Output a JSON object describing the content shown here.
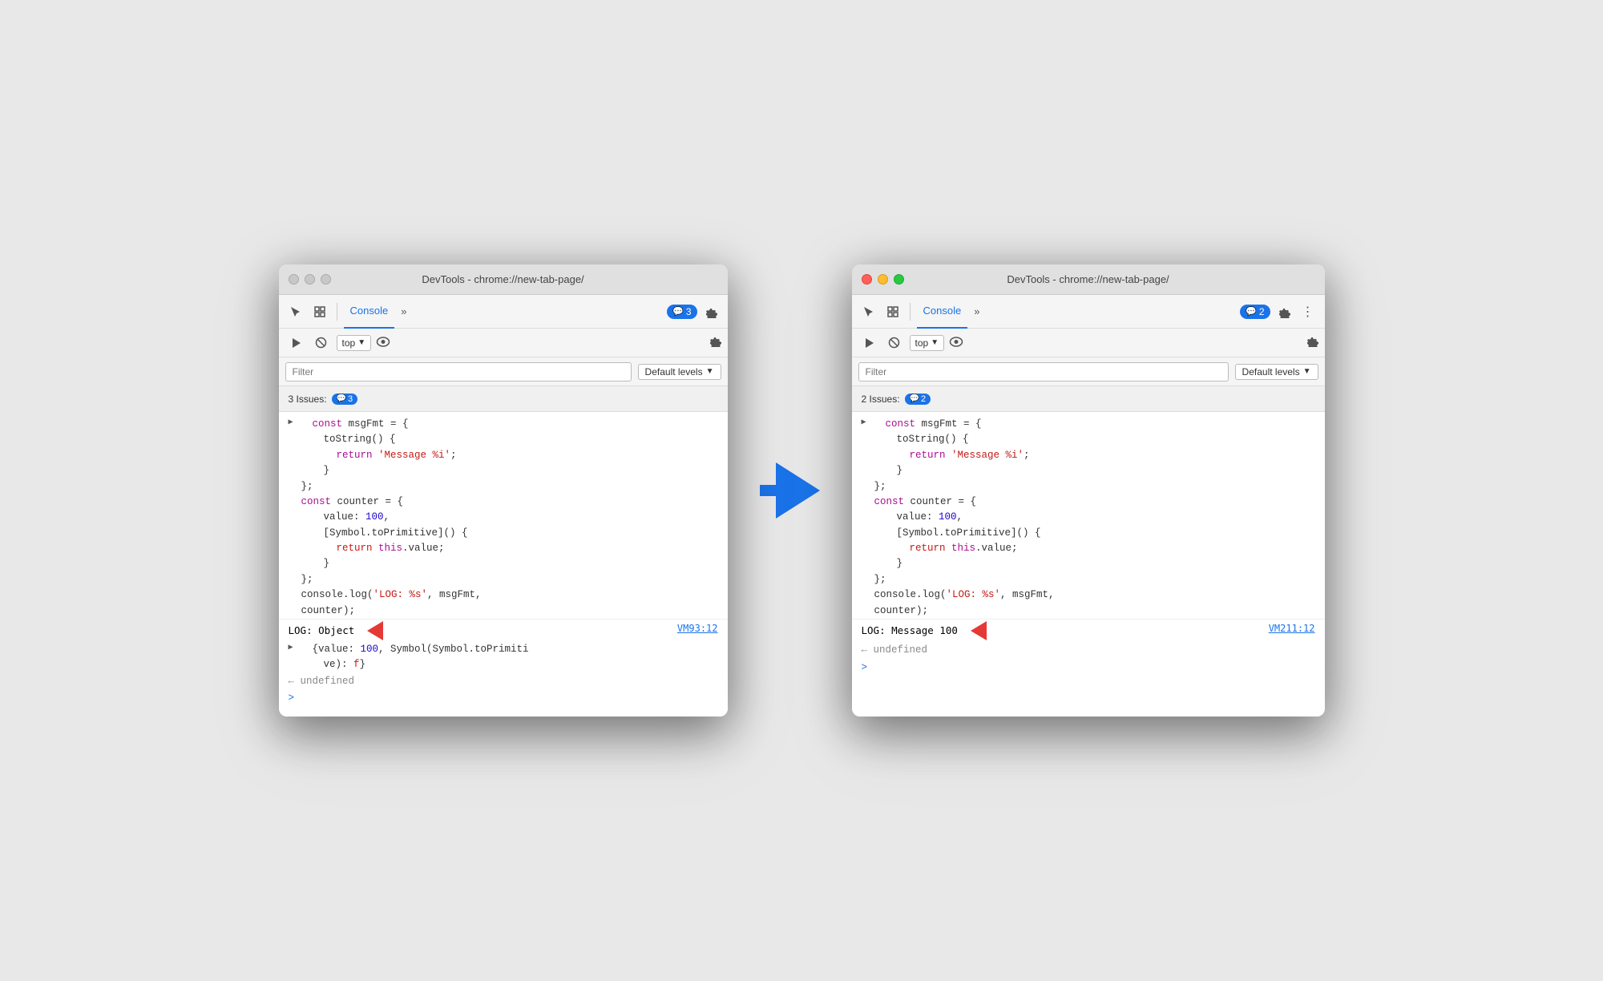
{
  "window_left": {
    "title": "DevTools - chrome://new-tab-page/",
    "tab": "Console",
    "badge_count": "3",
    "top_label": "top",
    "filter_placeholder": "Filter",
    "default_levels": "Default levels",
    "issues_count": "3 Issues:",
    "issues_badge": "3",
    "code": [
      {
        "type": "expand",
        "text": "const msgFmt = {",
        "keyword": "const",
        "rest": " msgFmt = {"
      },
      {
        "type": "indent1",
        "text": "toString() {"
      },
      {
        "type": "indent2",
        "text": "return 'Message %i';",
        "string": "'Message %i'"
      },
      {
        "type": "indent1",
        "text": "}"
      },
      {
        "type": "normal",
        "text": "};"
      },
      {
        "type": "normal",
        "text": "const counter = {",
        "keyword": "const"
      },
      {
        "type": "indent1",
        "text": "value: 100,",
        "number": "100"
      },
      {
        "type": "indent1",
        "text": "[Symbol.toPrimitive]() {"
      },
      {
        "type": "indent2",
        "text": "return this.value;",
        "keyword": "return"
      },
      {
        "type": "indent1",
        "text": "}"
      },
      {
        "type": "normal",
        "text": "};"
      },
      {
        "type": "normal",
        "text": "console.log('LOG: %s', msgFmt,"
      },
      {
        "type": "normal",
        "text": "counter);"
      }
    ],
    "log_output": "LOG: Object",
    "log_link": "VM93:12",
    "log_obj": "{value: 100, Symbol(Symbol.toPrimiti",
    "log_obj2": "ve): f}",
    "undefined_text": "← undefined",
    "prompt": ">"
  },
  "window_right": {
    "title": "DevTools - chrome://new-tab-page/",
    "tab": "Console",
    "badge_count": "2",
    "top_label": "top",
    "filter_placeholder": "Filter",
    "default_levels": "Default levels",
    "issues_count": "2 Issues:",
    "issues_badge": "2",
    "code": [
      {
        "type": "expand",
        "text": "const msgFmt = {",
        "keyword": "const",
        "rest": " msgFmt = {"
      },
      {
        "type": "indent1",
        "text": "toString() {"
      },
      {
        "type": "indent2",
        "text": "return 'Message %i';",
        "string": "'Message %i'"
      },
      {
        "type": "indent1",
        "text": "}"
      },
      {
        "type": "normal",
        "text": "};"
      },
      {
        "type": "normal",
        "text": "const counter = {",
        "keyword": "const"
      },
      {
        "type": "indent1",
        "text": "value: 100,",
        "number": "100"
      },
      {
        "type": "indent1",
        "text": "[Symbol.toPrimitive]() {"
      },
      {
        "type": "indent2",
        "text": "return this.value;",
        "keyword": "return"
      },
      {
        "type": "indent1",
        "text": "}"
      },
      {
        "type": "normal",
        "text": "};"
      },
      {
        "type": "normal",
        "text": "console.log('LOG: %s', msgFmt,"
      },
      {
        "type": "normal",
        "text": "counter);"
      }
    ],
    "log_output": "LOG: Message 100",
    "log_link": "VM211:12",
    "undefined_text": "← undefined",
    "prompt": ">"
  },
  "icons": {
    "cursor": "↖",
    "layers": "⧉",
    "more": "»",
    "block": "⊘",
    "eye": "👁",
    "gear": "⚙",
    "three_dots": "⋮",
    "play": "▶",
    "down": "▼",
    "chat": "💬"
  }
}
